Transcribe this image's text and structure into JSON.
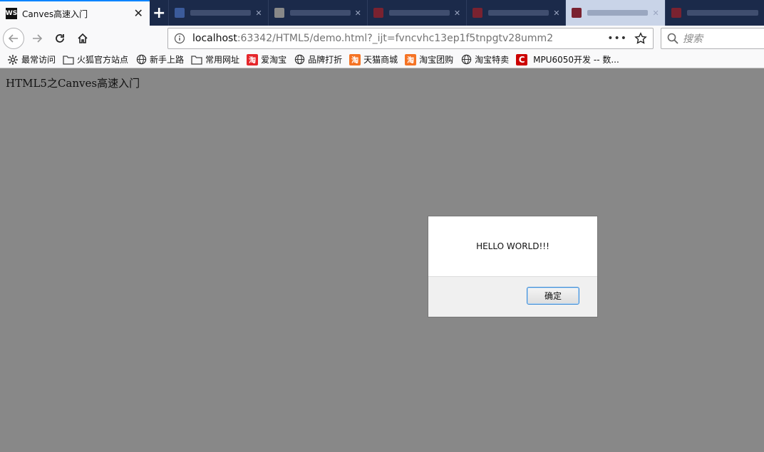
{
  "browser": {
    "active_tab": {
      "title": "Canves高速入门",
      "favicon": "WS"
    },
    "url": {
      "host": "localhost",
      "rest": ":63342/HTML5/demo.html?_ijt=fvncvhc13ep1f5tnpgtv28umm2"
    },
    "search": {
      "placeholder": "搜索"
    },
    "bookmarks": [
      {
        "label": "最常访问",
        "icon": "gear-icon"
      },
      {
        "label": "火狐官方站点",
        "icon": "folder-icon"
      },
      {
        "label": "新手上路",
        "icon": "globe-icon"
      },
      {
        "label": "常用网址",
        "icon": "folder-icon"
      },
      {
        "label": "爱淘宝",
        "icon": "taobao-icon",
        "glyph": "淘"
      },
      {
        "label": "品牌打折",
        "icon": "globe-icon"
      },
      {
        "label": "天猫商城",
        "icon": "tmall-icon",
        "glyph": "淘"
      },
      {
        "label": "淘宝团购",
        "icon": "taobao-icon",
        "glyph": "淘"
      },
      {
        "label": "淘宝特卖",
        "icon": "globe-icon"
      },
      {
        "label": "MPU6050开发 -- 数...",
        "icon": "csdn-icon",
        "glyph": "C"
      }
    ]
  },
  "page": {
    "heading": "HTML5之Canves高速入门"
  },
  "dialog": {
    "message": "HELLO WORLD!!!",
    "ok_label": "确定"
  }
}
